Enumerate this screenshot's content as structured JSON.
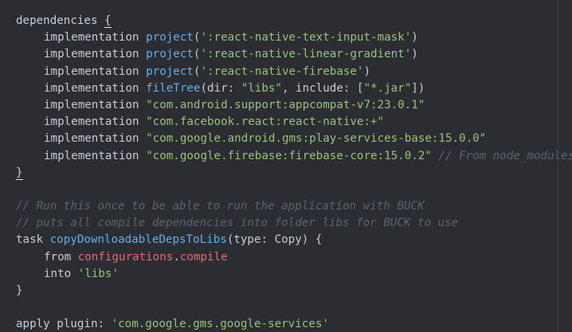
{
  "editor": {
    "lines": [
      [
        {
          "t": "dependencies ",
          "c": "plain"
        },
        {
          "t": "{",
          "c": "cursor"
        }
      ],
      [
        {
          "t": "implementation ",
          "c": "plain",
          "indent": true
        },
        {
          "t": "project",
          "c": "fn"
        },
        {
          "t": "(",
          "c": "plain"
        },
        {
          "t": "':react-native-text-input-mask'",
          "c": "str"
        },
        {
          "t": ")",
          "c": "plain"
        }
      ],
      [
        {
          "t": "implementation ",
          "c": "plain",
          "indent": true
        },
        {
          "t": "project",
          "c": "fn"
        },
        {
          "t": "(",
          "c": "plain"
        },
        {
          "t": "':react-native-linear-gradient'",
          "c": "str"
        },
        {
          "t": ")",
          "c": "plain"
        }
      ],
      [
        {
          "t": "implementation ",
          "c": "plain",
          "indent": true
        },
        {
          "t": "project",
          "c": "fn"
        },
        {
          "t": "(",
          "c": "plain"
        },
        {
          "t": "':react-native-firebase'",
          "c": "str"
        },
        {
          "t": ")",
          "c": "plain"
        }
      ],
      [
        {
          "t": "implementation ",
          "c": "plain",
          "indent": true
        },
        {
          "t": "fileTree",
          "c": "fn"
        },
        {
          "t": "(dir: ",
          "c": "plain"
        },
        {
          "t": "\"libs\"",
          "c": "str"
        },
        {
          "t": ", include: [",
          "c": "plain"
        },
        {
          "t": "\"*.jar\"",
          "c": "str"
        },
        {
          "t": "])",
          "c": "plain"
        }
      ],
      [
        {
          "t": "implementation ",
          "c": "plain",
          "indent": true
        },
        {
          "t": "\"com.android.support:appcompat-v7:23.0.1\"",
          "c": "str"
        }
      ],
      [
        {
          "t": "implementation ",
          "c": "plain",
          "indent": true
        },
        {
          "t": "\"com.facebook.react:react-native:+\"",
          "c": "str"
        }
      ],
      [
        {
          "t": "implementation ",
          "c": "plain",
          "indent": true
        },
        {
          "t": "\"com.google.android.gms:play-services-base:15.0.0\"",
          "c": "str"
        }
      ],
      [
        {
          "t": "implementation ",
          "c": "plain",
          "indent": true
        },
        {
          "t": "\"com.google.firebase:firebase-core:15.0.2\"",
          "c": "str"
        },
        {
          "t": " // From node_modules",
          "c": "comment"
        }
      ],
      [
        {
          "t": "}",
          "c": "cursor"
        }
      ],
      [],
      [
        {
          "t": "// Run this once to be able to run the application with BUCK",
          "c": "comment"
        }
      ],
      [
        {
          "t": "// puts all compile dependencies into folder libs for BUCK to use",
          "c": "comment"
        }
      ],
      [
        {
          "t": "task ",
          "c": "plain"
        },
        {
          "t": "copyDownloadableDepsToLibs",
          "c": "fn"
        },
        {
          "t": "(type: Copy) {",
          "c": "plain"
        }
      ],
      [
        {
          "t": "from ",
          "c": "plain",
          "indent": true
        },
        {
          "t": "configurations",
          "c": "prop"
        },
        {
          "t": ".",
          "c": "plain"
        },
        {
          "t": "compile",
          "c": "prop"
        }
      ],
      [
        {
          "t": "into ",
          "c": "plain",
          "indent": true
        },
        {
          "t": "'libs'",
          "c": "str"
        }
      ],
      [
        {
          "t": "}",
          "c": "plain"
        }
      ],
      [],
      [
        {
          "t": "apply plugin: ",
          "c": "plain"
        },
        {
          "t": "'com.google.gms.google-services'",
          "c": "str"
        }
      ]
    ]
  }
}
